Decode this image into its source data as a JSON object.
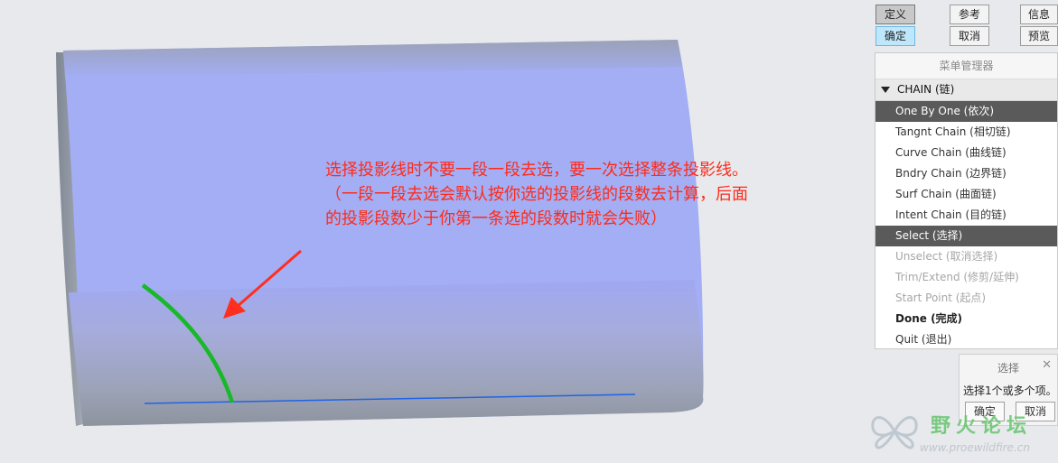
{
  "annotation": {
    "lines": [
      "选择投影线时不要一段一段去选，要一次选择整条投影线。",
      "（一段一段去选会默认按你选的投影线的段数去计算，后面",
      "的投影段数少于你第一条选的段数时就会失败）"
    ],
    "color": "#ff2a1a"
  },
  "top_buttons": {
    "define": "定义",
    "reference": "参考",
    "info": "信息",
    "ok": "确定",
    "cancel": "取消",
    "preview": "预览"
  },
  "menu_manager": {
    "title": "菜单管理器",
    "header": "CHAIN (链)",
    "items": [
      {
        "label": "One By One (依次)",
        "state": "selected"
      },
      {
        "label": "Tangnt Chain (相切链)",
        "state": "normal"
      },
      {
        "label": "Curve Chain (曲线链)",
        "state": "normal"
      },
      {
        "label": "Bndry Chain (边界链)",
        "state": "normal"
      },
      {
        "label": "Surf Chain (曲面链)",
        "state": "normal"
      },
      {
        "label": "Intent Chain (目的链)",
        "state": "normal"
      },
      {
        "label": "Select (选择)",
        "state": "selected"
      },
      {
        "label": "Unselect (取消选择)",
        "state": "disabled"
      },
      {
        "label": "Trim/Extend (修剪/延伸)",
        "state": "disabled"
      },
      {
        "label": "Start Point (起点)",
        "state": "disabled"
      },
      {
        "label": "Done (完成)",
        "state": "bold"
      },
      {
        "label": "Quit (退出)",
        "state": "normal"
      }
    ]
  },
  "select_dialog": {
    "title": "选择",
    "close_icon": "close-icon",
    "prompt": "选择1个或多个项。",
    "ok": "确定",
    "cancel": "取消"
  },
  "watermark": {
    "text": "野火论坛",
    "url": "www.proewildfire.cn"
  },
  "colors": {
    "surface": "#a3aef5",
    "curve": "#19b82a",
    "edge_line": "#1f63e6",
    "arrow": "#ff2f1f"
  }
}
